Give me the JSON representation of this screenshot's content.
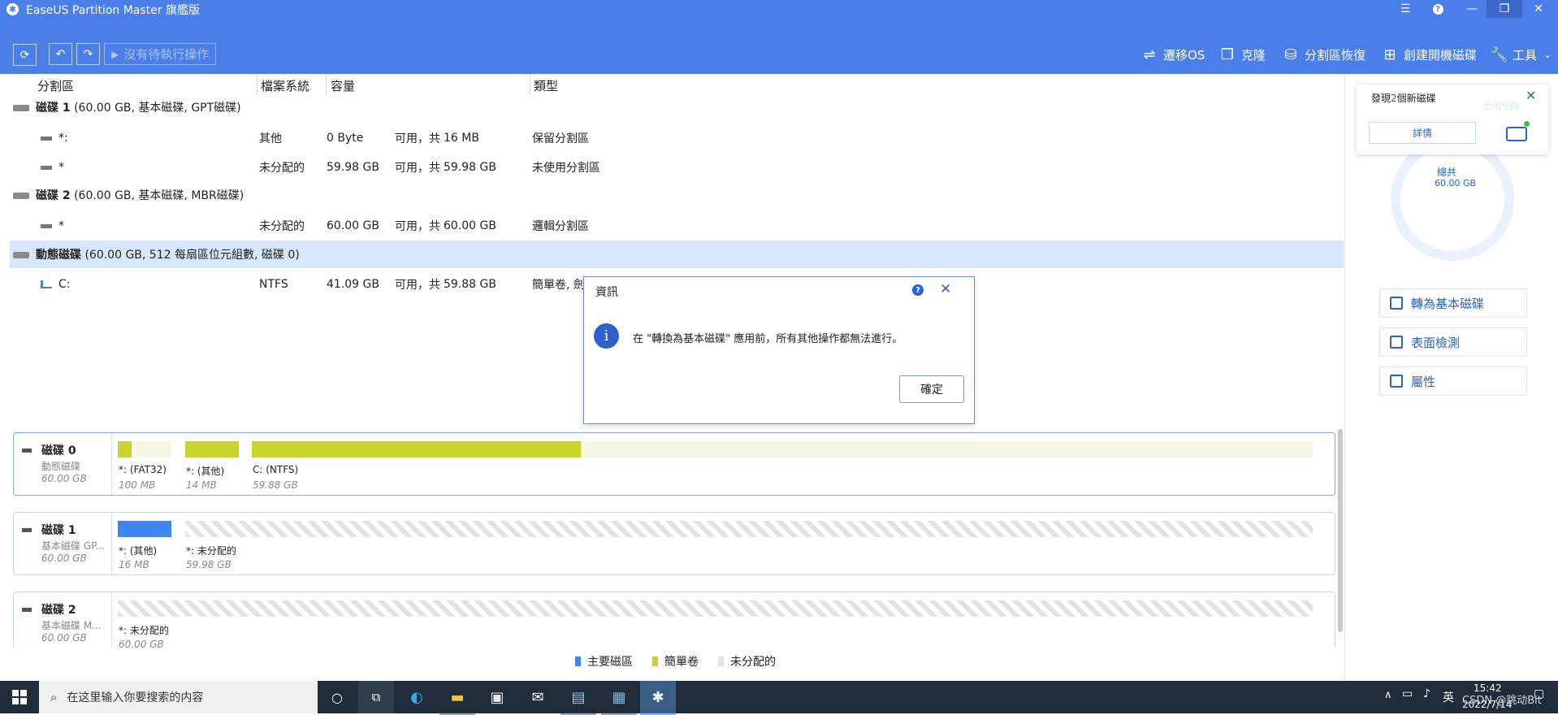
{
  "window": {
    "title": "EaseUS Partition Master 旗艦版",
    "controls": [
      "list-icon",
      "help-icon",
      "minimize-icon",
      "restore-icon",
      "close-icon"
    ]
  },
  "toolbar": {
    "pending_label": "沒有待執行操作",
    "tools": [
      {
        "label": "遷移OS",
        "icon": "migrate-icon"
      },
      {
        "label": "克隆",
        "icon": "clone-icon"
      },
      {
        "label": "分割區恢復",
        "icon": "recovery-icon"
      },
      {
        "label": "創建開機磁碟",
        "icon": "bootable-icon"
      },
      {
        "label": "工具",
        "icon": "wrench-icon"
      }
    ]
  },
  "table": {
    "headers": [
      "分割區",
      "檔案系統",
      "容量",
      "類型"
    ],
    "disks": [
      {
        "name": "磁碟 1",
        "info": "(60.00 GB, 基本磁碟, GPT磁碟)",
        "partitions": [
          {
            "name": "*:",
            "fs": "其他",
            "used": "0 Byte",
            "total_label": "可用，共",
            "total": "16 MB",
            "type": "保留分割區"
          },
          {
            "name": "*",
            "fs": "未分配的",
            "used": "59.98 GB",
            "total_label": "可用，共",
            "total": "59.98 GB",
            "type": "未使用分割區"
          }
        ]
      },
      {
        "name": "磁碟 2",
        "info": "(60.00 GB, 基本磁碟, MBR磁碟)",
        "partitions": [
          {
            "name": "*",
            "fs": "未分配的",
            "used": "60.00 GB",
            "total_label": "可用，共",
            "total": "60.00 GB",
            "type": "邏輯分割區"
          }
        ]
      },
      {
        "name": "動態磁碟",
        "info": "(60.00 GB, 512 每扇區位元組數, 磁碟 0)",
        "selected": true,
        "partitions": [
          {
            "name": "C:",
            "fs": "NTFS",
            "used": "41.09 GB",
            "total_label": "可用，共",
            "total": "59.88 GB",
            "type": "簡單卷, 劍"
          }
        ]
      }
    ]
  },
  "disk_map": [
    {
      "name": "磁碟 0",
      "kind": "動態磁碟",
      "size": "60.00 GB",
      "parts": [
        {
          "label": "*: (FAT32)",
          "size": "100 MB",
          "fill": 0.25,
          "color": "#c8d42a"
        },
        {
          "label": "*: (其他)",
          "size": "14 MB",
          "fill": 1.0,
          "color": "#c8d42a"
        },
        {
          "label": "C: (NTFS)",
          "size": "59.88 GB",
          "fill": 0.31,
          "color": "#c8d42a"
        }
      ]
    },
    {
      "name": "磁碟 1",
      "kind": "基本磁碟 GP...",
      "size": "60.00 GB",
      "parts": [
        {
          "label": "*: (其他)",
          "size": "16 MB",
          "fill": 1.0,
          "color": "#3f86f5"
        },
        {
          "label": "*: 未分配的",
          "size": "59.98 GB",
          "fill": 0.0,
          "color": "#e2e2e2"
        }
      ]
    },
    {
      "name": "磁碟 2",
      "kind": "基本磁碟 M...",
      "size": "60.00 GB",
      "parts": [
        {
          "label": "*: 未分配的",
          "size": "60.00 GB",
          "fill": 0.0,
          "color": "#e2e2e2"
        }
      ]
    }
  ],
  "legend": [
    {
      "label": "主要磁區",
      "color": "#3f86f5"
    },
    {
      "label": "簡單卷",
      "color": "#c8d42a"
    },
    {
      "label": "未分配的",
      "color": "#e2e2e2"
    }
  ],
  "dialog": {
    "title": "資訊",
    "message": "在 \"轉換為基本磁碟\" 應用前，所有其他操作都無法進行。",
    "ok_label": "確定"
  },
  "notification": {
    "text_pre": "發現",
    "count": "2",
    "text_post": "個新磁碟",
    "details_label": "詳情",
    "ghost_text": "已用空間"
  },
  "summary": {
    "total_label": "總共",
    "total_value": "60.00 GB"
  },
  "actions": [
    {
      "label": "轉為基本磁碟",
      "icon": "convert-icon"
    },
    {
      "label": "表面檢測",
      "icon": "surface-test-icon"
    },
    {
      "label": "屬性",
      "icon": "properties-icon"
    }
  ],
  "taskbar": {
    "search_placeholder": "在这里输入你要搜索的内容",
    "tray": {
      "lang": "英",
      "time": "15:42",
      "date": "2022/7/14",
      "watermark": "CSDN @跳动Bit"
    }
  }
}
